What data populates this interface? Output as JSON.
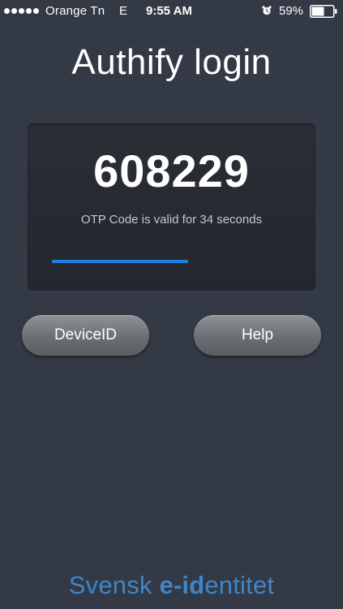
{
  "status_bar": {
    "carrier": "Orange Tn",
    "network": "E",
    "time": "9:55 AM",
    "battery": "59%",
    "battery_level": 0.59,
    "signal_bars": 5,
    "icons": [
      "signal-dots-icon",
      "alarm-clock-icon",
      "battery-icon"
    ]
  },
  "title": "Authify login",
  "otp": {
    "code": "608229",
    "validity_text": "OTP Code is valid for 34 seconds",
    "progress_fraction": 0.57,
    "progress_color": "#1f7ce0"
  },
  "buttons": {
    "device_id": "DeviceID",
    "help": "Help"
  },
  "brand": {
    "part1": "Svensk ",
    "part2": "e-id",
    "part3": "entitet",
    "color": "#3f86c9"
  },
  "colors": {
    "background": "#333945",
    "card": "#272a30",
    "button": "#6b6e73"
  }
}
